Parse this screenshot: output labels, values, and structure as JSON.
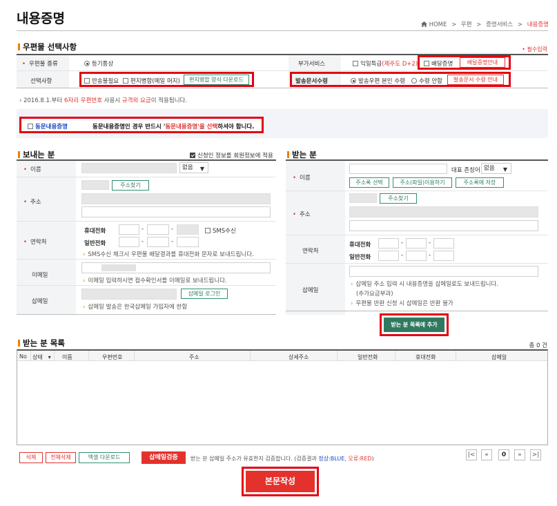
{
  "page_title": "내용증명",
  "breadcrumb": {
    "home": "HOME",
    "sep": ">",
    "b1": "우편",
    "b2": "증명서비스",
    "current": "내용증명"
  },
  "required_note": "• 필수입력",
  "section1": {
    "title": "우편물 선택사항",
    "mail_type_label": "우편물 종류",
    "mail_type_value": "등기통상",
    "addon_label": "부가서비스",
    "addon_next_day": "익일특급",
    "addon_next_day_note": "(제주도 D+2)",
    "addon_delivery_proof": "배달증명",
    "delivery_guide_btn": "배달증명안내",
    "options_label": "선택사항",
    "opt_return_unneeded": "반송불필요",
    "opt_merge": "편지병합(메일 머지)",
    "merge_download_btn": "편지병합 양식 다운로드",
    "return_doc_label": "발송문서수령",
    "return_self": "발송우편 본인 수령",
    "return_none": "수령 안함",
    "return_guide_btn": "발송문서 수령 안내",
    "notice_pre": "› 2016.8.1.부터 ",
    "notice_red1": "6자리 우편번호",
    "notice_mid": " 사용시 ",
    "notice_red2": "규격외 요금",
    "notice_post": "이 적용됩니다."
  },
  "same_content": {
    "checkbox_label": "동문내용증명",
    "msg_pre": "동문내용증명인 경우 반드시 '",
    "msg_red": "동문내용증명'을 선택",
    "msg_post": "하셔야 합니다."
  },
  "sender": {
    "title": "보내는 분",
    "apply_member_info": "신청인 정보를 회원정보에 적용",
    "name_label": "이름",
    "honorific": "없음",
    "address_label": "주소",
    "find_address_btn": "주소찾기",
    "contact_label": "연락처",
    "mobile_label": "휴대전화",
    "sms_label": "SMS수신",
    "phone_label": "일반전화",
    "sms_note": "SMS수신 체크시 우편물 배달결과를 휴대전화 문자로 보내드립니다.",
    "email_label": "이메일",
    "email_note": "이메일 입력하시면 접수확인서를 이메일로 보내드립니다.",
    "shipmail_label": "삽메일",
    "shipmail_login_btn": "삽메일 로그인",
    "shipmail_note": "삽메일 발송은 한국삽메일 가입자에 한함"
  },
  "receiver": {
    "title": "받는 분",
    "name_label": "이름",
    "honorific_label": "대표 존칭어",
    "honorific": "없음",
    "select_address_book_btn": "주소록 선택",
    "address_file_btn": "주소(파일)이용하기",
    "save_address_book_btn": "주소록에 저장",
    "address_label": "주소",
    "find_address_btn": "주소찾기",
    "contact_label": "연락처",
    "mobile_label": "휴대전화",
    "phone_label": "일반전화",
    "shipmail_label": "삽메일",
    "shipmail_note1": "삽메일 주소 입력 시 내용증명을 삽메일로도 보내드립니다.",
    "shipmail_note2": "(추가요금부과)",
    "shipmail_note3": "우편물 반환 신청 시 삽메일은 반환 불가",
    "add_to_list_btn": "받는 분 목록에 추가"
  },
  "list": {
    "title": "받는 분 목록",
    "total": "총 0 건",
    "columns": [
      "No",
      "상태",
      "이름",
      "우편번호",
      "주소",
      "상세주소",
      "일반전화",
      "휴대전화",
      "삽메일"
    ],
    "status_caret": "⌄"
  },
  "bottom": {
    "delete_btn": "삭제",
    "delete_all_btn": "전체삭제",
    "excel_download_btn": "엑셀 다운로드",
    "shipmail_verify_btn": "삽메일검증",
    "verify_note_pre": "받는 분 삽메일 주소가 유효한지 검증합니다. (검증결과 ",
    "verify_ok": "정상:BLUE",
    "verify_sep": ", ",
    "verify_err": "오류:RED",
    "verify_note_post": ")",
    "page_first": "|<",
    "page_prev": "«",
    "page_current": "0",
    "page_next": "»",
    "page_last": ">|",
    "compose_btn": "본문작성"
  },
  "colors": {
    "accent_red": "#e4312c",
    "brand_green": "#2f8f6f",
    "highlight": "#e40010"
  }
}
